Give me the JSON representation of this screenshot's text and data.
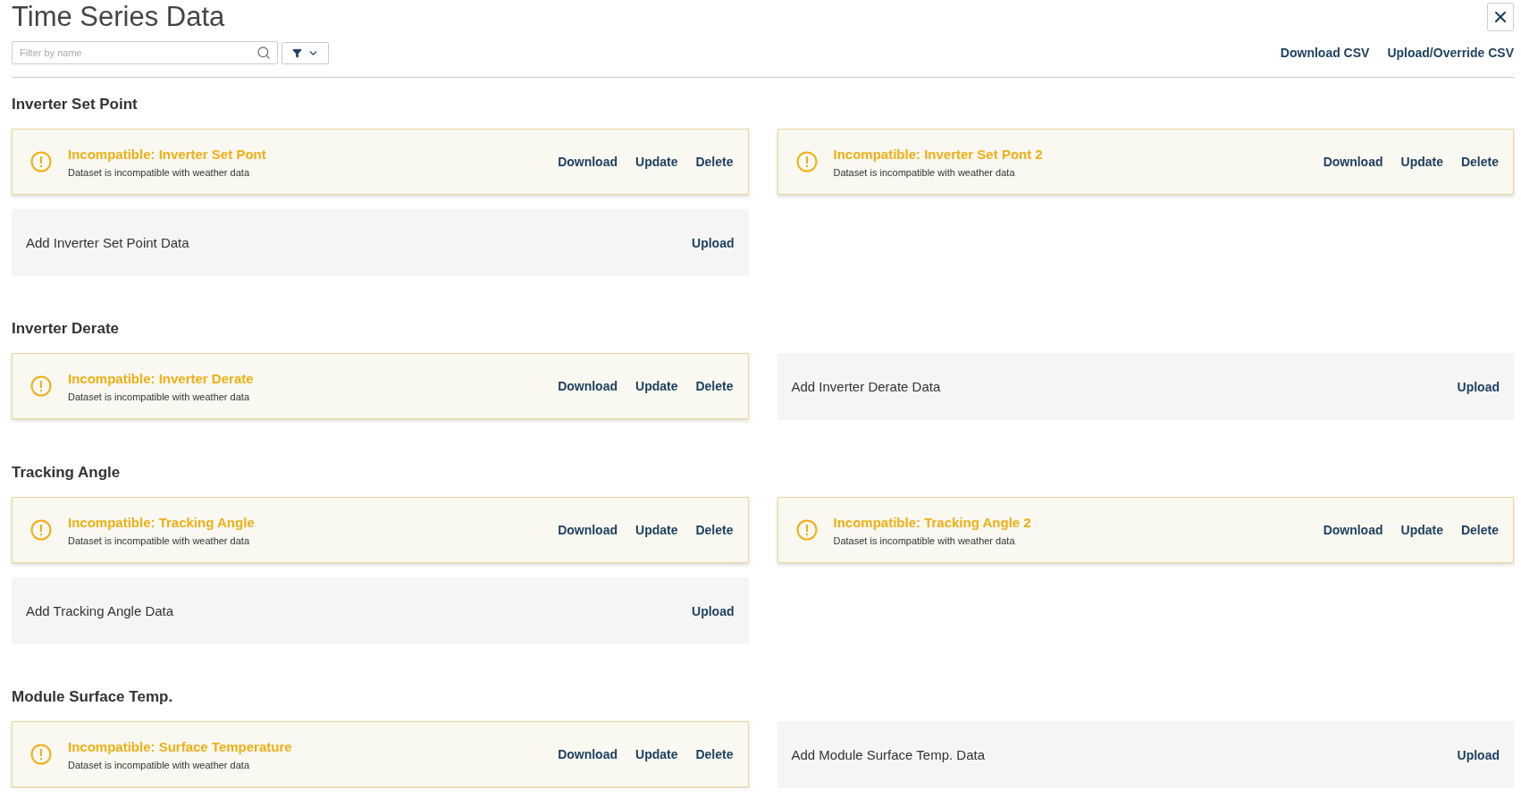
{
  "title": "Time Series Data",
  "search": {
    "placeholder": "Filter by name"
  },
  "header_links": [
    "Download CSV",
    "Upload/Override CSV"
  ],
  "sections": [
    {
      "heading": "Inverter Set Point",
      "items": [
        {
          "kind": "dataset",
          "title": "Incompatible: Inverter Set Pont",
          "subtitle": "Dataset is incompatible with weather data",
          "actions": [
            "Download",
            "Update",
            "Delete"
          ]
        },
        {
          "kind": "dataset",
          "title": "Incompatible: Inverter Set Pont 2",
          "subtitle": "Dataset is incompatible with weather data",
          "actions": [
            "Download",
            "Update",
            "Delete"
          ]
        },
        {
          "kind": "add",
          "label": "Add Inverter Set Point Data",
          "action": "Upload"
        }
      ]
    },
    {
      "heading": "Inverter Derate",
      "items": [
        {
          "kind": "dataset",
          "title": "Incompatible: Inverter Derate",
          "subtitle": "Dataset is incompatible with weather data",
          "actions": [
            "Download",
            "Update",
            "Delete"
          ]
        },
        {
          "kind": "add",
          "label": "Add Inverter Derate Data",
          "action": "Upload"
        }
      ]
    },
    {
      "heading": "Tracking Angle",
      "items": [
        {
          "kind": "dataset",
          "title": "Incompatible: Tracking Angle",
          "subtitle": "Dataset is incompatible with weather data",
          "actions": [
            "Download",
            "Update",
            "Delete"
          ]
        },
        {
          "kind": "dataset",
          "title": "Incompatible: Tracking Angle 2",
          "subtitle": "Dataset is incompatible with weather data",
          "actions": [
            "Download",
            "Update",
            "Delete"
          ]
        },
        {
          "kind": "add",
          "label": "Add Tracking Angle Data",
          "action": "Upload"
        }
      ]
    },
    {
      "heading": "Module Surface Temp.",
      "items": [
        {
          "kind": "dataset",
          "title": "Incompatible: Surface Temperature",
          "subtitle": "Dataset is incompatible with weather data",
          "actions": [
            "Download",
            "Update",
            "Delete"
          ]
        },
        {
          "kind": "add",
          "label": "Add Module Surface Temp. Data",
          "action": "Upload"
        }
      ]
    }
  ]
}
